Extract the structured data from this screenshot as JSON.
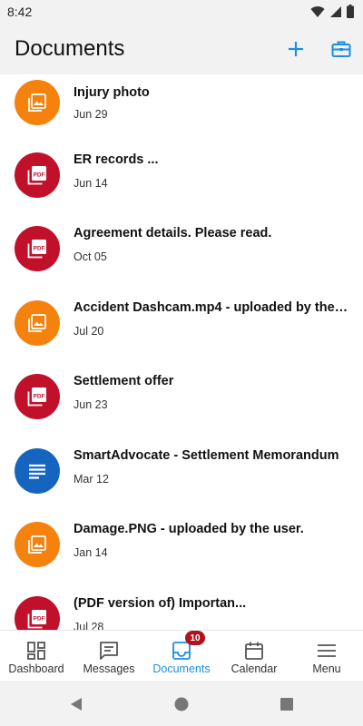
{
  "status_bar": {
    "time": "8:42"
  },
  "header": {
    "title": "Documents",
    "add_icon": "plus-icon",
    "briefcase_icon": "briefcase-icon"
  },
  "documents": [
    {
      "title": "Injury photo",
      "date": "Jun 29",
      "type": "image"
    },
    {
      "title": "ER records ...",
      "date": "Jun 14",
      "type": "pdf"
    },
    {
      "title": "Agreement details. Please read.",
      "date": "Oct 05",
      "type": "pdf"
    },
    {
      "title": "Accident Dashcam.mp4 - uploaded by the u...",
      "date": "Jul 20",
      "type": "image"
    },
    {
      "title": "Settlement offer",
      "date": "Jun 23",
      "type": "pdf"
    },
    {
      "title": "SmartAdvocate - Settlement Memorandum",
      "date": "Mar 12",
      "type": "doc"
    },
    {
      "title": "Damage.PNG - uploaded by the user.",
      "date": "Jan 14",
      "type": "image"
    },
    {
      "title": "(PDF version of) Importan...",
      "date": "Jul 28",
      "type": "pdf"
    }
  ],
  "icon_colors": {
    "image": "#f5820d",
    "pdf": "#c0102a",
    "doc": "#1565c0"
  },
  "pdf_label": "PDF",
  "nav": {
    "items": [
      {
        "label": "Dashboard",
        "icon": "dashboard-icon"
      },
      {
        "label": "Messages",
        "icon": "messages-icon"
      },
      {
        "label": "Documents",
        "icon": "documents-icon",
        "badge": "10",
        "active": true
      },
      {
        "label": "Calendar",
        "icon": "calendar-icon"
      },
      {
        "label": "Menu",
        "icon": "menu-icon"
      }
    ]
  },
  "colors": {
    "accent": "#1a8fe3",
    "badge": "#b0121e"
  }
}
